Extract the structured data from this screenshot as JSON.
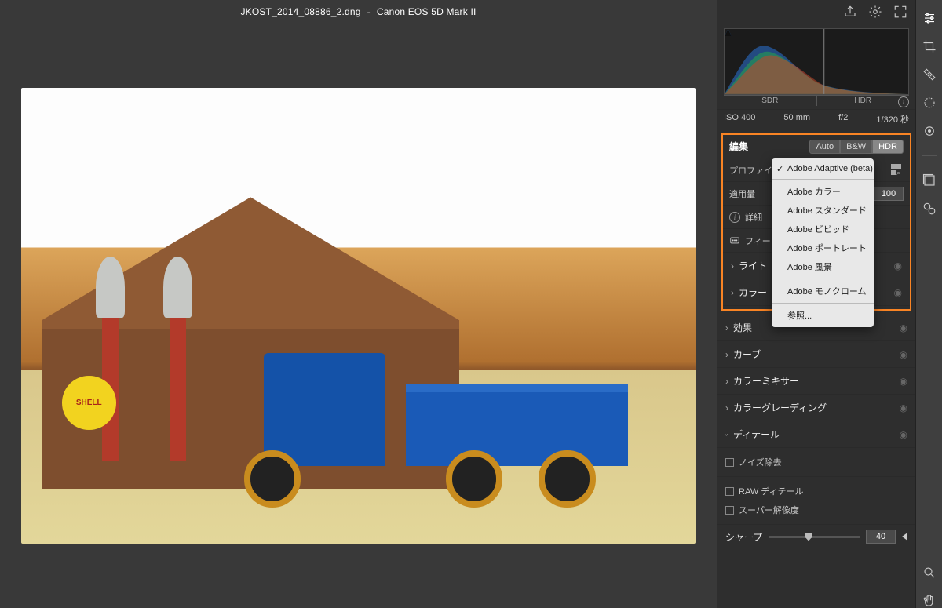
{
  "title": {
    "filename": "JKOST_2014_08886_2.dng",
    "camera": "Canon EOS 5D Mark II"
  },
  "sign_text": "SHELL",
  "histogram": {
    "ranges": [
      "SDR",
      "HDR"
    ]
  },
  "meta": {
    "iso": "ISO 400",
    "focal": "50 mm",
    "aperture": "f/2",
    "shutter": "1/320 秒"
  },
  "edit": {
    "label": "編集",
    "auto": "Auto",
    "bw": "B&W",
    "hdr": "HDR",
    "profile_label": "プロファイル",
    "amount_label": "適用量",
    "amount_value": "100",
    "details_label": "詳細",
    "feedback_label": "フィー"
  },
  "profile_menu": {
    "selected": "Adobe Adaptive (beta)",
    "group1": [
      "Adobe カラー",
      "Adobe スタンダード",
      "Adobe ビビッド",
      "Adobe ポートレート",
      "Adobe 風景"
    ],
    "group2": [
      "Adobe モノクローム"
    ],
    "browse": "参照..."
  },
  "panels": {
    "light": "ライト",
    "color": "カラー",
    "effects": "効果",
    "curve": "カーブ",
    "mixer": "カラーミキサー",
    "grading": "カラーグレーディング",
    "detail": "ディテール"
  },
  "detail": {
    "denoise": "ノイズ除去",
    "raw": "RAW ディテール",
    "super": "スーパー解像度",
    "sharp_label": "シャープ",
    "sharp_value": "40"
  }
}
